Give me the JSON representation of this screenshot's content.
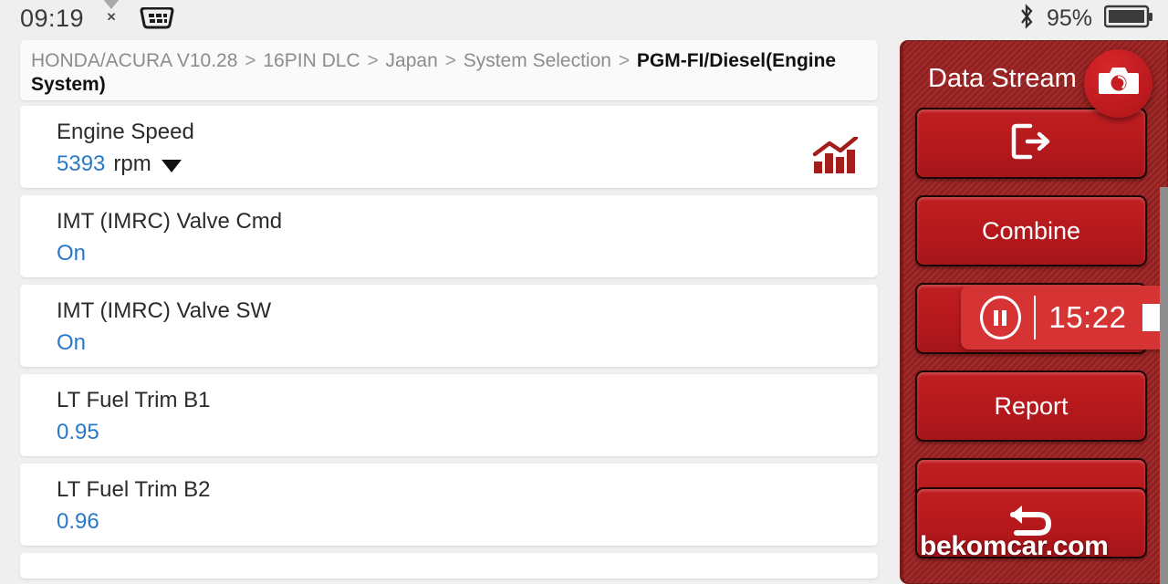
{
  "statusbar": {
    "time": "09:19",
    "wifi_icon": "wifi-off-icon",
    "obd_icon": "obd-connector-icon",
    "bluetooth_icon": "bluetooth-icon",
    "battery_percent": "95%",
    "battery_icon": "battery-icon"
  },
  "breadcrumb": {
    "items": [
      "HONDA/ACURA V10.28",
      "16PIN DLC",
      "Japan",
      "System Selection"
    ],
    "separator": ">",
    "current": "PGM-FI/Diesel(Engine System)"
  },
  "data_stream": {
    "rows": [
      {
        "name": "Engine Speed",
        "value": "5393",
        "unit": "rpm",
        "has_graph": true,
        "has_caret": true
      },
      {
        "name": "IMT (IMRC) Valve Cmd",
        "value": "On",
        "unit": "",
        "has_graph": false,
        "has_caret": false
      },
      {
        "name": "IMT (IMRC) Valve SW",
        "value": "On",
        "unit": "",
        "has_graph": false,
        "has_caret": false
      },
      {
        "name": "LT Fuel Trim B1",
        "value": "0.95",
        "unit": "",
        "has_graph": false,
        "has_caret": false
      },
      {
        "name": "LT Fuel Trim B2",
        "value": "0.96",
        "unit": "",
        "has_graph": false,
        "has_caret": false
      }
    ]
  },
  "panel": {
    "title": "Data Stream",
    "camera_icon": "camera-icon",
    "buttons": [
      {
        "label": "",
        "icon": "exit-icon"
      },
      {
        "label": "Combine",
        "icon": ""
      },
      {
        "label": "",
        "icon": ""
      },
      {
        "label": "Report",
        "icon": ""
      },
      {
        "label": "",
        "icon": ""
      },
      {
        "label": "",
        "icon": "back-arrow-icon"
      }
    ]
  },
  "recording": {
    "pause_icon": "pause-icon",
    "elapsed": "15:22",
    "stop_icon": "stop-icon"
  },
  "watermark": {
    "text": "bekomcar.com"
  },
  "colors": {
    "accent_red": "#b5181c",
    "panel_red": "#9c2222",
    "value_blue": "#2979c9",
    "bright_red": "#d63434",
    "page_bg": "#efefef"
  }
}
